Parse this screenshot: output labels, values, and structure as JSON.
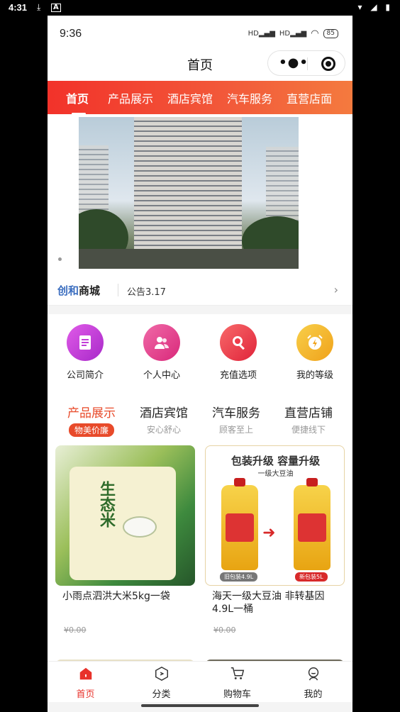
{
  "outer_status": {
    "time": "4:31"
  },
  "phone_status": {
    "time": "9:36",
    "battery": "85"
  },
  "navbar": {
    "title": "首页"
  },
  "tabs": [
    "首页",
    "产品展示",
    "酒店宾馆",
    "汽车服务",
    "直营店面"
  ],
  "notice": {
    "brand_part1": "创和",
    "brand_part2": "商城",
    "text": "公告3.17"
  },
  "shortcuts": [
    {
      "label": "公司简介",
      "icon": "document-icon",
      "color": "#c13ed8"
    },
    {
      "label": "个人中心",
      "icon": "people-icon",
      "color": "#e53e8f"
    },
    {
      "label": "充值选项",
      "icon": "search-icon",
      "color": "#ef3a4a"
    },
    {
      "label": "我的等级",
      "icon": "alarm-clock-icon",
      "color": "#f3b62a"
    }
  ],
  "categories": [
    {
      "title": "产品展示",
      "sub": "物美价廉"
    },
    {
      "title": "酒店宾馆",
      "sub": "安心舒心"
    },
    {
      "title": "汽车服务",
      "sub": "顾客至上"
    },
    {
      "title": "直营店铺",
      "sub": "便捷线下"
    }
  ],
  "products": [
    {
      "name": "小雨点泗洪大米5kg一袋",
      "price": "¥0.00",
      "image_text": "生态米"
    },
    {
      "name": "海天一级大豆油 非转基因4.9L一桶",
      "price": "¥0.00",
      "image_headline": "包装升级  容量升级",
      "image_sub": "一级大豆油",
      "badge_old": "旧包装4.9L",
      "badge_new": "新包装5L"
    }
  ],
  "tabbar": [
    "首页",
    "分类",
    "购物车",
    "我的"
  ],
  "colors": {
    "accent": "#e8312a",
    "brand_blue": "#3a6dbf"
  }
}
